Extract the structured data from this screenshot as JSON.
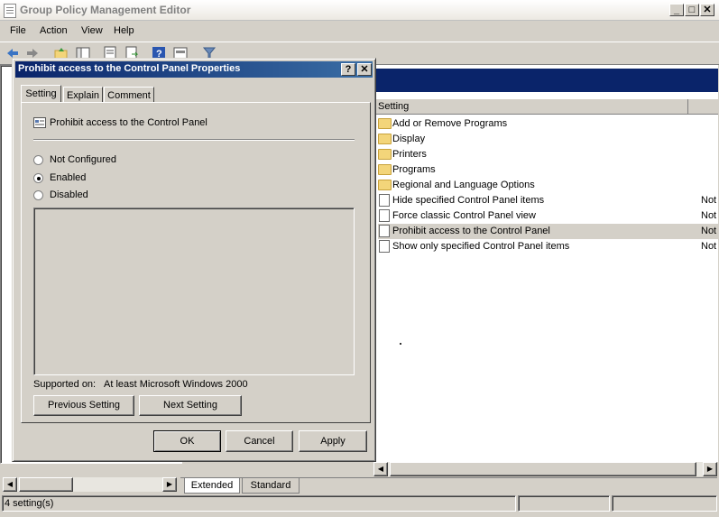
{
  "window": {
    "title": "Group Policy Management Editor",
    "min": "_",
    "max": "□",
    "close": "✕"
  },
  "menu": [
    "File",
    "Action",
    "View",
    "Help"
  ],
  "list": {
    "column_setting": "Setting",
    "rows": [
      {
        "label": "Add or Remove Programs",
        "type": "folder",
        "state": ""
      },
      {
        "label": "Display",
        "type": "folder",
        "state": ""
      },
      {
        "label": "Printers",
        "type": "folder",
        "state": ""
      },
      {
        "label": "Programs",
        "type": "folder",
        "state": ""
      },
      {
        "label": "Regional and Language Options",
        "type": "folder",
        "state": ""
      },
      {
        "label": "Hide specified Control Panel items",
        "type": "setting",
        "state": "Not"
      },
      {
        "label": "Force classic Control Panel view",
        "type": "setting",
        "state": "Not"
      },
      {
        "label": "Prohibit access to the Control Panel",
        "type": "setting",
        "state": "Not"
      },
      {
        "label": "Show only specified Control Panel items",
        "type": "setting",
        "state": "Not"
      }
    ]
  },
  "bottom_tabs": {
    "extended": "Extended",
    "standard": "Standard"
  },
  "status": {
    "text": "4 setting(s)"
  },
  "dialog": {
    "title": "Prohibit access to the Control Panel Properties",
    "help": "?",
    "close": "✕",
    "tabs": [
      "Setting",
      "Explain",
      "Comment"
    ],
    "policy_name": "Prohibit access to the Control Panel",
    "options": [
      "Not Configured",
      "Enabled",
      "Disabled"
    ],
    "selected": "Enabled",
    "supported_label": "Supported on:",
    "supported_value": "At least Microsoft Windows 2000",
    "prev": "Previous Setting",
    "next": "Next Setting",
    "ok": "OK",
    "cancel": "Cancel",
    "apply": "Apply"
  }
}
